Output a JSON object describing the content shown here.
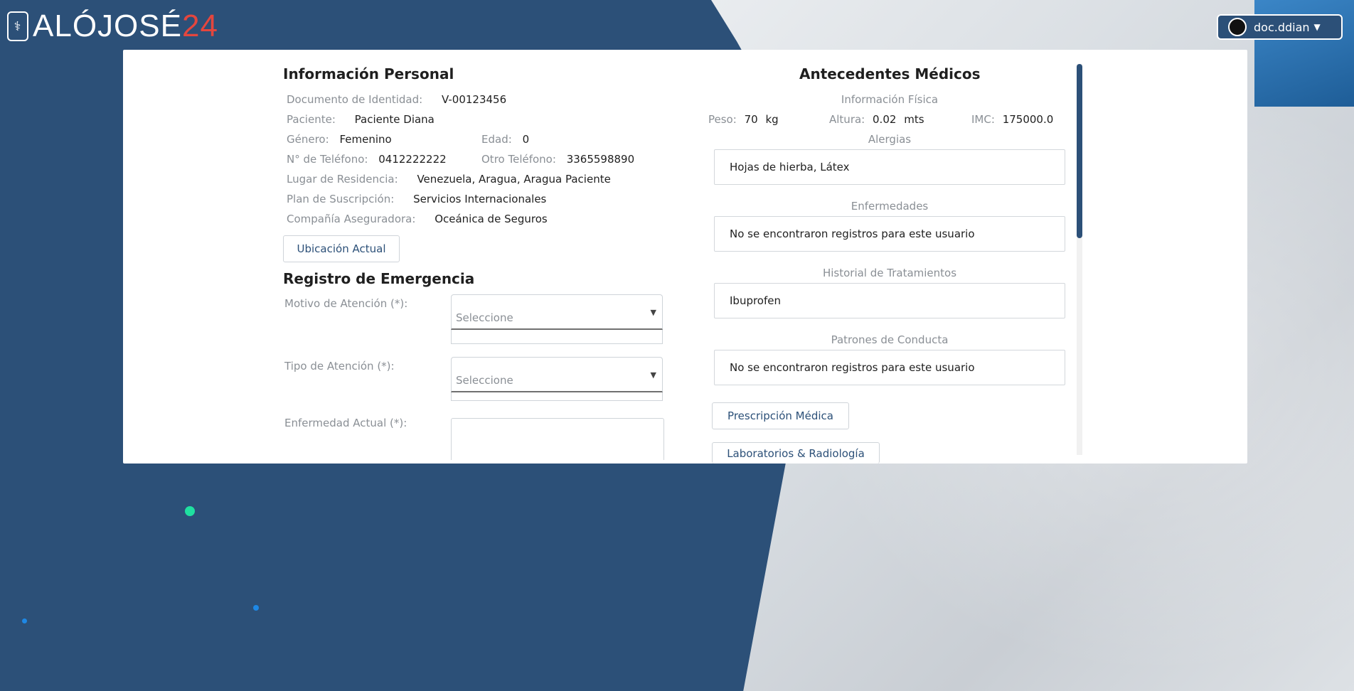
{
  "app": {
    "logo_text": "ALÓJOSÉ",
    "logo_accent": "24"
  },
  "user": {
    "name": "doc.ddian"
  },
  "personal": {
    "title": "Información Personal",
    "documento_label": "Documento de Identidad:",
    "documento_value": "V-00123456",
    "paciente_label": "Paciente:",
    "paciente_value": "Paciente Diana",
    "genero_label": "Género:",
    "genero_value": "Femenino",
    "edad_label": "Edad:",
    "edad_value": "0",
    "telefono_label": "N° de Teléfono:",
    "telefono_value": "0412222222",
    "otro_tel_label": "Otro Teléfono:",
    "otro_tel_value": "3365598890",
    "residencia_label": "Lugar de Residencia:",
    "residencia_value": "Venezuela, Aragua, Aragua Paciente",
    "plan_label": "Plan de Suscripción:",
    "plan_value": "Servicios Internacionales",
    "aseguradora_label": "Compañía Aseguradora:",
    "aseguradora_value": "Oceánica de Seguros",
    "ubicacion_button": "Ubicación Actual"
  },
  "emergencia": {
    "title": "Registro de Emergencia",
    "motivo_label": "Motivo de Atención (*):",
    "motivo_placeholder": "Seleccione",
    "tipo_label": "Tipo de Atención (*):",
    "tipo_placeholder": "Seleccione",
    "enfermedad_label": "Enfermedad Actual (*):"
  },
  "antecedentes": {
    "title": "Antecedentes Médicos",
    "info_fisica_label": "Información Física",
    "peso_label": "Peso:",
    "peso_value": "70",
    "peso_unit": "kg",
    "altura_label": "Altura:",
    "altura_value": "0.02",
    "altura_unit": "mts",
    "imc_label": "IMC:",
    "imc_value": "175000.0",
    "alergias_label": "Alergias",
    "alergias_value": "Hojas de hierba, Látex",
    "enfermedades_label": "Enfermedades",
    "enfermedades_value": "No se encontraron registros para este usuario",
    "tratamientos_label": "Historial de Tratamientos",
    "tratamientos_value": "Ibuprofen",
    "patrones_label": "Patrones de Conducta",
    "patrones_value": "No se encontraron registros para este usuario",
    "prescripcion_button": "Prescripción Médica",
    "laboratorios_button": "Laboratorios & Radiología"
  },
  "colors": {
    "primary": "#2c5078",
    "accent": "#e4463e",
    "dot_green": "#1fe0a0",
    "dot_blue": "#1e88e5"
  }
}
